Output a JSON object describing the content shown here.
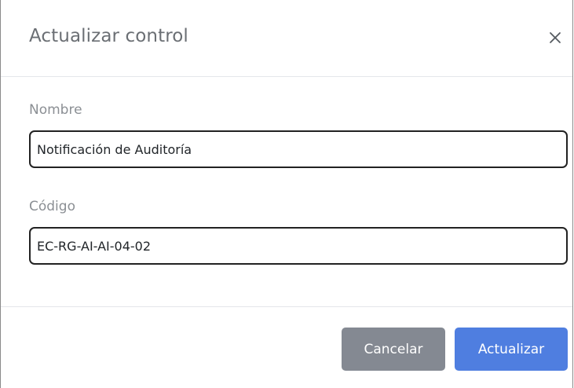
{
  "dialog": {
    "title": "Actualizar control",
    "close_icon": "close-icon"
  },
  "form": {
    "nombre_label": "Nombre",
    "nombre_value": "Notificación de Auditoría",
    "codigo_label": "Código",
    "codigo_value": "EC-RG-AI-AI-04-02"
  },
  "footer": {
    "cancel_label": "Cancelar",
    "update_label": "Actualizar"
  },
  "colors": {
    "primary": "#4f7ee0",
    "secondary": "#848992",
    "title_text": "#6b6f74",
    "label_text": "#8b8f94"
  }
}
